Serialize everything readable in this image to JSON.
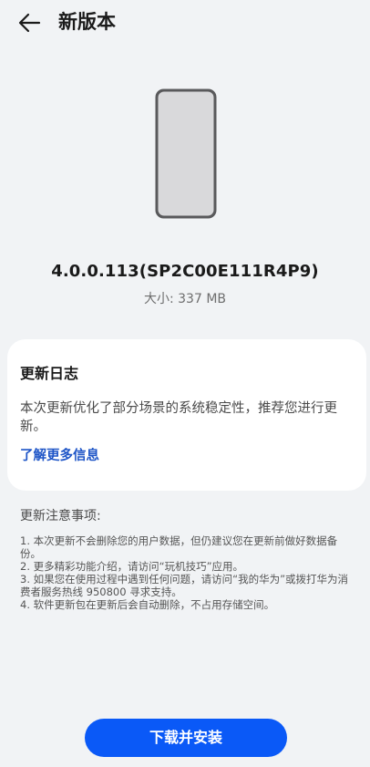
{
  "header": {
    "title": "新版本",
    "back_icon": "arrow-left-icon"
  },
  "device": {
    "icon": "phone-icon",
    "version": "4.0.0.113(SP2C00E111R4P9)",
    "size_label": "大小: 337 MB"
  },
  "changelog": {
    "title": "更新日志",
    "body": "本次更新优化了部分场景的系统稳定性，推荐您进行更新。",
    "link": "了解更多信息"
  },
  "notes": {
    "title": "更新注意事项:",
    "items": [
      "1. 本次更新不会删除您的用户数据，但仍建议您在更新前做好数据备份。",
      "2. 更多精彩功能介绍，请访问“玩机技巧”应用。",
      "3. 如果您在使用过程中遇到任何问题，请访问“我的华为”或拨打华为消费者服务热线 950800 寻求支持。",
      "4. 软件更新包在更新后会自动删除，不占用存储空间。"
    ]
  },
  "install_button": {
    "label": "下载并安装"
  },
  "colors": {
    "background": "#f1f3f5",
    "card": "#ffffff",
    "accent": "#0a59f7",
    "link": "#1e55c7"
  }
}
